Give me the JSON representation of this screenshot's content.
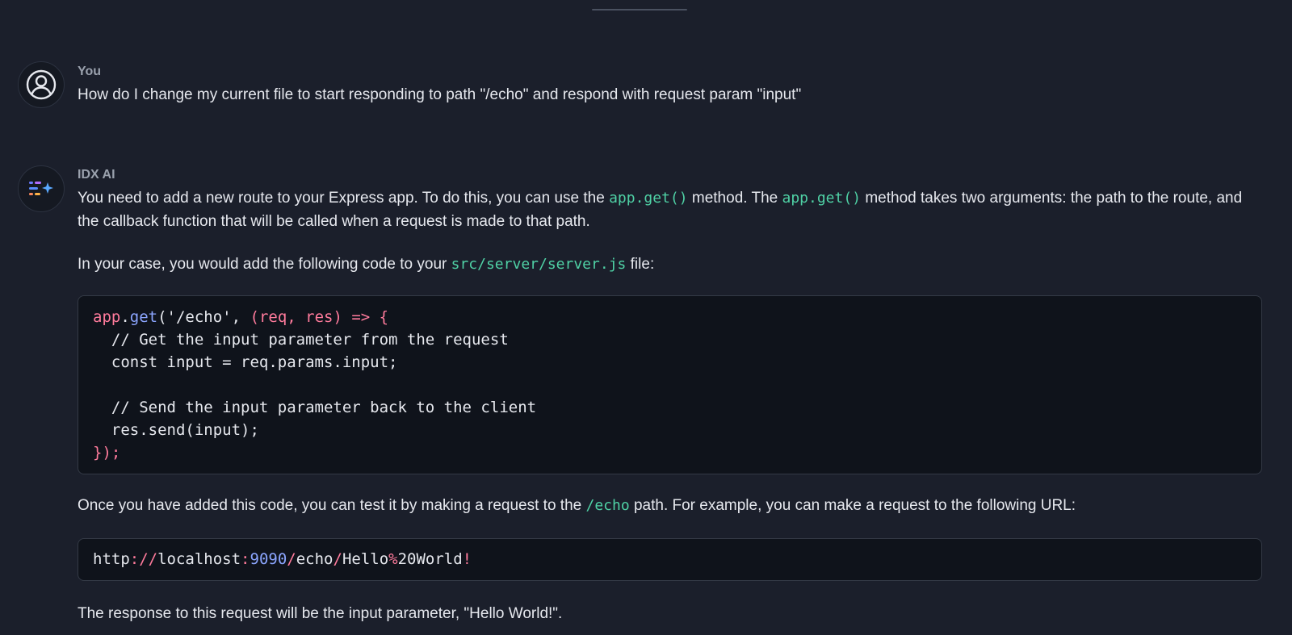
{
  "messages": {
    "user": {
      "sender": "You",
      "avatar_icon": "user-circle-icon",
      "text": "How do I change my current file to start responding to path \"/echo\" and respond with request param \"input\""
    },
    "ai": {
      "sender": "IDX AI",
      "avatar_icon": "idx-ai-logo-icon",
      "para1": {
        "t1": "You need to add a new route to your Express app. To do this, you can use the ",
        "c1": "app.get()",
        "t2": " method. The ",
        "c2": "app.get()",
        "t3": " method takes two arguments: the path to the route, and the callback function that will be called when a request is made to that path."
      },
      "para2": {
        "t1": "In your case, you would add the following code to your ",
        "c1": "src/server/server.js",
        "t2": " file:"
      },
      "code": {
        "line1": {
          "obj": "app",
          "dot": ".",
          "fn": "get",
          "args": "('/echo', ",
          "params": "(req, res)",
          "arrow": " => {"
        },
        "line2": "  // Get the input parameter from the request",
        "line3": "  const input = req.params.input;",
        "line5": "  // Send the input parameter back to the client",
        "line6": "  res.send(input);",
        "line7": {
          "brace": "}",
          "rest": ");"
        }
      },
      "para3": {
        "t1": "Once you have added this code, you can test it by making a request to the ",
        "c1": "/echo",
        "t2": " path. For example, you can make a request to the following URL:"
      },
      "url": {
        "scheme": "http",
        "sep": "://",
        "host": "localhost",
        "colon": ":",
        "port": "9090",
        "slash1": "/",
        "seg": "echo",
        "slash2": "/",
        "name": "Hello",
        "pct": "%",
        "enc": "20World",
        "bang": "!"
      },
      "para4": "The response to this request will be the input parameter, \"Hello World!\"."
    }
  },
  "colors": {
    "background": "#1b1f2b",
    "inline_code": "#4fd1a5",
    "code_keyword": "#ff7b9c",
    "code_function": "#8ca6ff",
    "code_block_bg": "#0f131b"
  }
}
